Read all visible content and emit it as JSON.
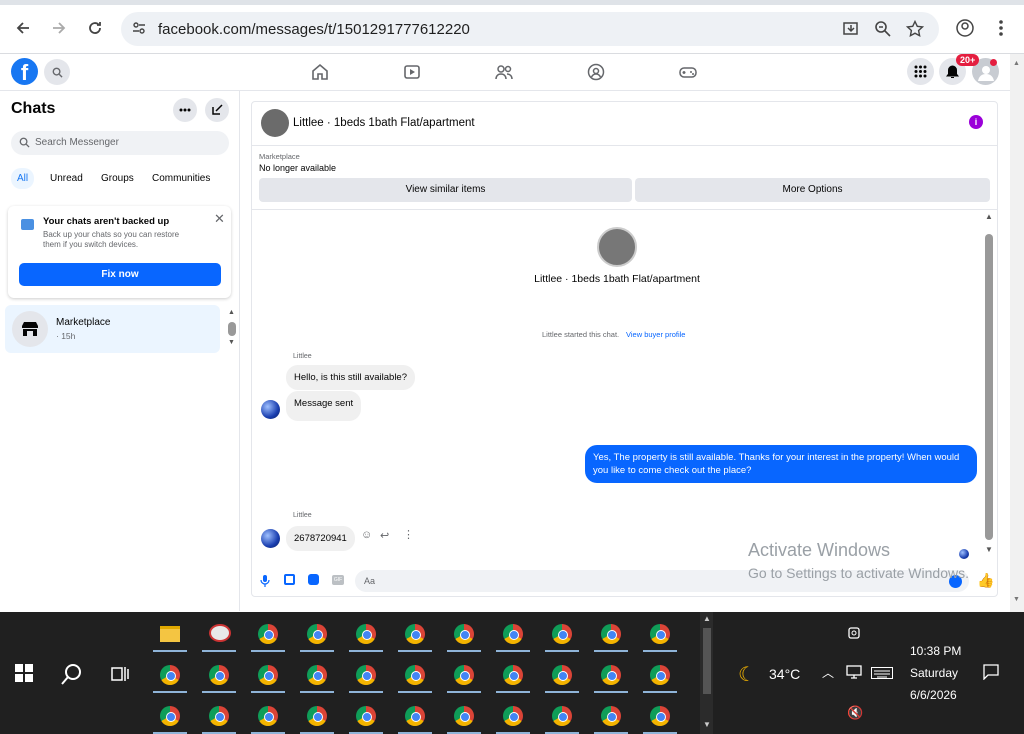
{
  "browser": {
    "url": "facebook.com/messages/t/1501291777612220"
  },
  "fb": {
    "logo": "f",
    "notif_badge": "20+"
  },
  "sidebar": {
    "title": "Chats",
    "search_placeholder": "Search Messenger",
    "filters": [
      "All",
      "Unread",
      "Groups",
      "Communities"
    ],
    "notice": {
      "title": "Your chats aren't backed up",
      "body": "Back up your chats so you can restore them if you switch devices.",
      "button": "Fix now"
    },
    "conversation": {
      "name": "Marketplace",
      "time": "· 15h"
    }
  },
  "chat": {
    "title": "Littlee · 1beds 1bath Flat/apartment",
    "marketplace_label": "Marketplace",
    "status": "No longer available",
    "btn_similar": "View similar items",
    "btn_more": "More Options",
    "center_title": "Littlee · 1beds 1bath Flat/apartment",
    "started": "Littlee started this chat.",
    "view_profile": "View buyer profile",
    "sender": "Littlee",
    "msg1": "Hello, is this still available?",
    "msg2": "Message sent",
    "reply": "Yes, The property is still available. Thanks for your interest in the property! When would you like to come check out the place?",
    "sender2": "Littlee",
    "msg3": "2678720941",
    "composer_placeholder": "Aa"
  },
  "watermark": {
    "line1": "Activate Windows",
    "line2": "Go to Settings to activate Windows."
  },
  "taskbar": {
    "weather": "34°C",
    "time": "10:38 PM",
    "day": "Saturday",
    "date": "6/6/2026"
  },
  "colors": {
    "fb_blue": "#0866ff",
    "badge_red": "#e41e3f",
    "taskbar": "#202020"
  }
}
